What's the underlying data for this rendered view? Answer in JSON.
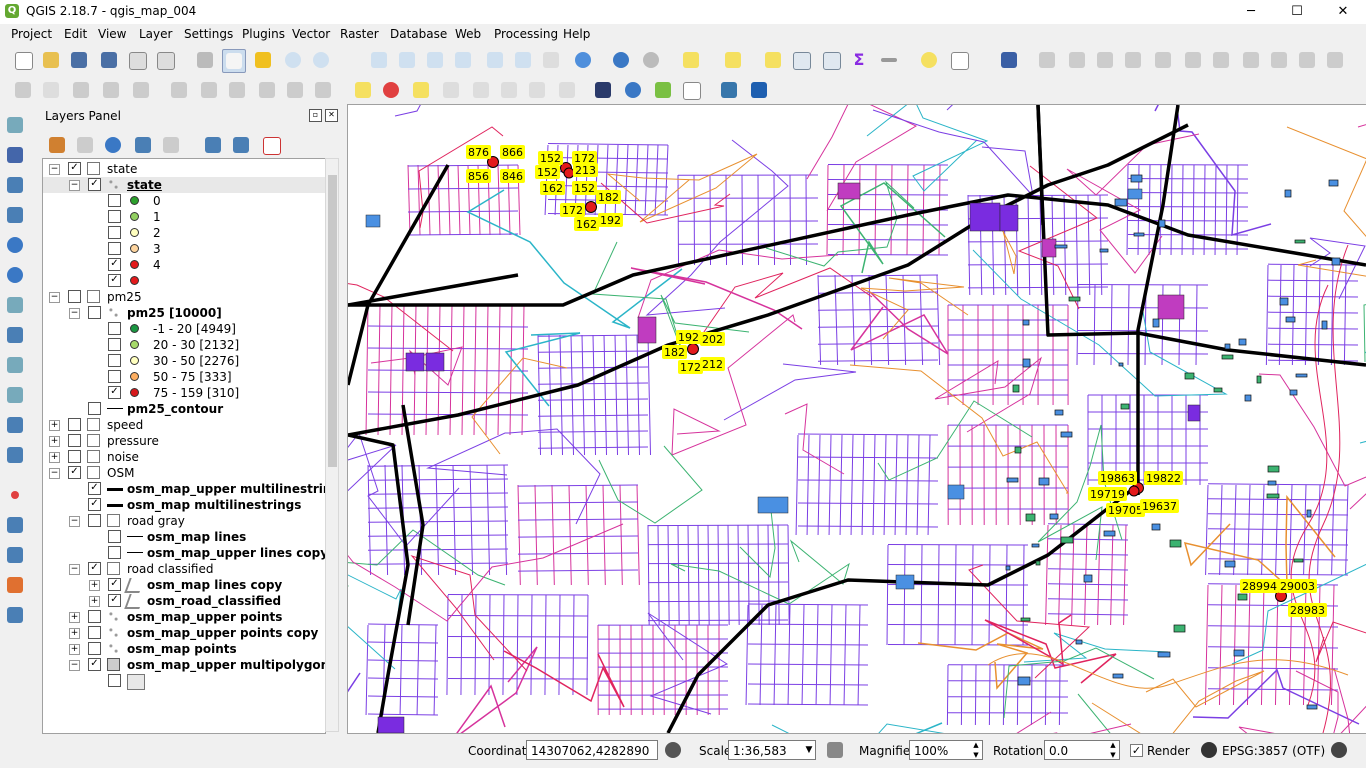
{
  "window": {
    "title": "QGIS 2.18.7 - qgis_map_004",
    "min": "─",
    "max": "☐",
    "close": "✕"
  },
  "menu": [
    "Project",
    "Edit",
    "View",
    "Layer",
    "Settings",
    "Plugins",
    "Vector",
    "Raster",
    "Database",
    "Web",
    "Processing",
    "Help"
  ],
  "panel": {
    "title": "Layers Panel"
  },
  "layers": [
    {
      "depth": 0,
      "exp": "−",
      "cb": "✓",
      "kind": "group",
      "label": "state",
      "bold": false
    },
    {
      "depth": 1,
      "exp": "−",
      "cb": "✓",
      "kind": "points",
      "label": "state",
      "bold": true,
      "selected": true
    },
    {
      "depth": 2,
      "cb": "",
      "kind": "class",
      "color": "#2ca02c",
      "label": "0"
    },
    {
      "depth": 2,
      "cb": "",
      "kind": "class",
      "color": "#91cf60",
      "label": "1"
    },
    {
      "depth": 2,
      "cb": "",
      "kind": "class",
      "color": "#ffffbf",
      "label": "2"
    },
    {
      "depth": 2,
      "cb": "",
      "kind": "class",
      "color": "#fdd49e",
      "label": "3"
    },
    {
      "depth": 2,
      "cb": "✓",
      "kind": "class",
      "color": "#e31a1c",
      "label": "4"
    },
    {
      "depth": 2,
      "cb": "✓",
      "kind": "class",
      "color": "#e31a1c",
      "label": ""
    },
    {
      "depth": 0,
      "exp": "−",
      "cb": "",
      "kind": "group",
      "label": "pm25",
      "bold": false
    },
    {
      "depth": 1,
      "exp": "−",
      "cb": "",
      "kind": "points",
      "label": "pm25 [10000]",
      "bold": true
    },
    {
      "depth": 2,
      "cb": "",
      "kind": "class",
      "color": "#1a9641",
      "label": "-1 - 20  [4949]"
    },
    {
      "depth": 2,
      "cb": "",
      "kind": "class",
      "color": "#a6d96a",
      "label": "20 - 30  [2132]"
    },
    {
      "depth": 2,
      "cb": "",
      "kind": "class",
      "color": "#ffffbf",
      "label": "30 - 50  [2276]"
    },
    {
      "depth": 2,
      "cb": "",
      "kind": "class",
      "color": "#fdae61",
      "label": "50 - 75  [333]"
    },
    {
      "depth": 2,
      "cb": "✓",
      "kind": "class",
      "color": "#d7191c",
      "label": "75 - 159  [310]"
    },
    {
      "depth": 1,
      "cb": "",
      "kind": "line",
      "label": "pm25_contour",
      "bold": true
    },
    {
      "depth": 0,
      "exp": "+",
      "cb": "",
      "kind": "group",
      "label": "speed",
      "bold": false
    },
    {
      "depth": 0,
      "exp": "+",
      "cb": "",
      "kind": "group",
      "label": "pressure",
      "bold": false
    },
    {
      "depth": 0,
      "exp": "+",
      "cb": "",
      "kind": "group",
      "label": "noise",
      "bold": false
    },
    {
      "depth": 0,
      "exp": "−",
      "cb": "✓",
      "kind": "group",
      "label": "OSM",
      "bold": false
    },
    {
      "depth": 1,
      "cb": "✓",
      "kind": "line",
      "label": "osm_map_upper multilinestrings",
      "bold": true
    },
    {
      "depth": 1,
      "cb": "✓",
      "kind": "line",
      "label": "osm_map multilinestrings",
      "bold": true
    },
    {
      "depth": 1,
      "exp": "−",
      "cb": "",
      "kind": "group",
      "label": "road gray",
      "bold": false
    },
    {
      "depth": 2,
      "cb": "",
      "kind": "line",
      "label": "osm_map lines",
      "bold": true
    },
    {
      "depth": 2,
      "cb": "",
      "kind": "line",
      "label": "osm_map_upper lines copy",
      "bold": true
    },
    {
      "depth": 1,
      "exp": "−",
      "cb": "✓",
      "kind": "group",
      "label": "road classified",
      "bold": false
    },
    {
      "depth": 2,
      "exp": "+",
      "cb": "✓",
      "kind": "multi",
      "label": "osm_map lines copy",
      "bold": true
    },
    {
      "depth": 2,
      "exp": "+",
      "cb": "✓",
      "kind": "multi",
      "label": "osm_road_classified",
      "bold": true
    },
    {
      "depth": 1,
      "exp": "+",
      "cb": "",
      "kind": "points",
      "label": "osm_map_upper points",
      "bold": true
    },
    {
      "depth": 1,
      "exp": "+",
      "cb": "",
      "kind": "points",
      "label": "osm_map_upper points copy",
      "bold": true
    },
    {
      "depth": 1,
      "exp": "+",
      "cb": "",
      "kind": "points",
      "label": "osm_map points",
      "bold": true
    },
    {
      "depth": 1,
      "exp": "−",
      "cb": "✓",
      "kind": "polygon",
      "label": "osm_map_upper multipolygons",
      "bold": true
    }
  ],
  "map_labels": [
    {
      "t": "876"
    },
    {
      "t": "866"
    },
    {
      "t": "856"
    },
    {
      "t": "846"
    },
    {
      "t": "152"
    },
    {
      "t": "172"
    },
    {
      "t": "152"
    },
    {
      "t": "213"
    },
    {
      "t": "162"
    },
    {
      "t": "152"
    },
    {
      "t": "182"
    },
    {
      "t": "172"
    },
    {
      "t": "162"
    },
    {
      "t": "192"
    },
    {
      "t": "192"
    },
    {
      "t": "202"
    },
    {
      "t": "182"
    },
    {
      "t": "172"
    },
    {
      "t": "212"
    },
    {
      "t": "19863"
    },
    {
      "t": "19822"
    },
    {
      "t": "19719"
    },
    {
      "t": "19705"
    },
    {
      "t": "19637"
    },
    {
      "t": "28994"
    },
    {
      "t": "29003"
    },
    {
      "t": "28983"
    }
  ],
  "status": {
    "coordinate_label": "Coordinate",
    "coordinate": "14307062,4282890",
    "scale_label": "Scale",
    "scale": "1:36,583",
    "magnifier_label": "Magnifier",
    "magnifier": "100%",
    "rotation_label": "Rotation",
    "rotation": "0.0",
    "render_label": "Render",
    "render_checked": "✓",
    "crs": "EPSG:3857 (OTF)"
  },
  "colors": {
    "accent_green": "#64a831",
    "label_yellow": "#ffff00",
    "point_red": "#e31a1c",
    "road_purple": "#7b3fe4",
    "road_magenta": "#d6339c"
  }
}
